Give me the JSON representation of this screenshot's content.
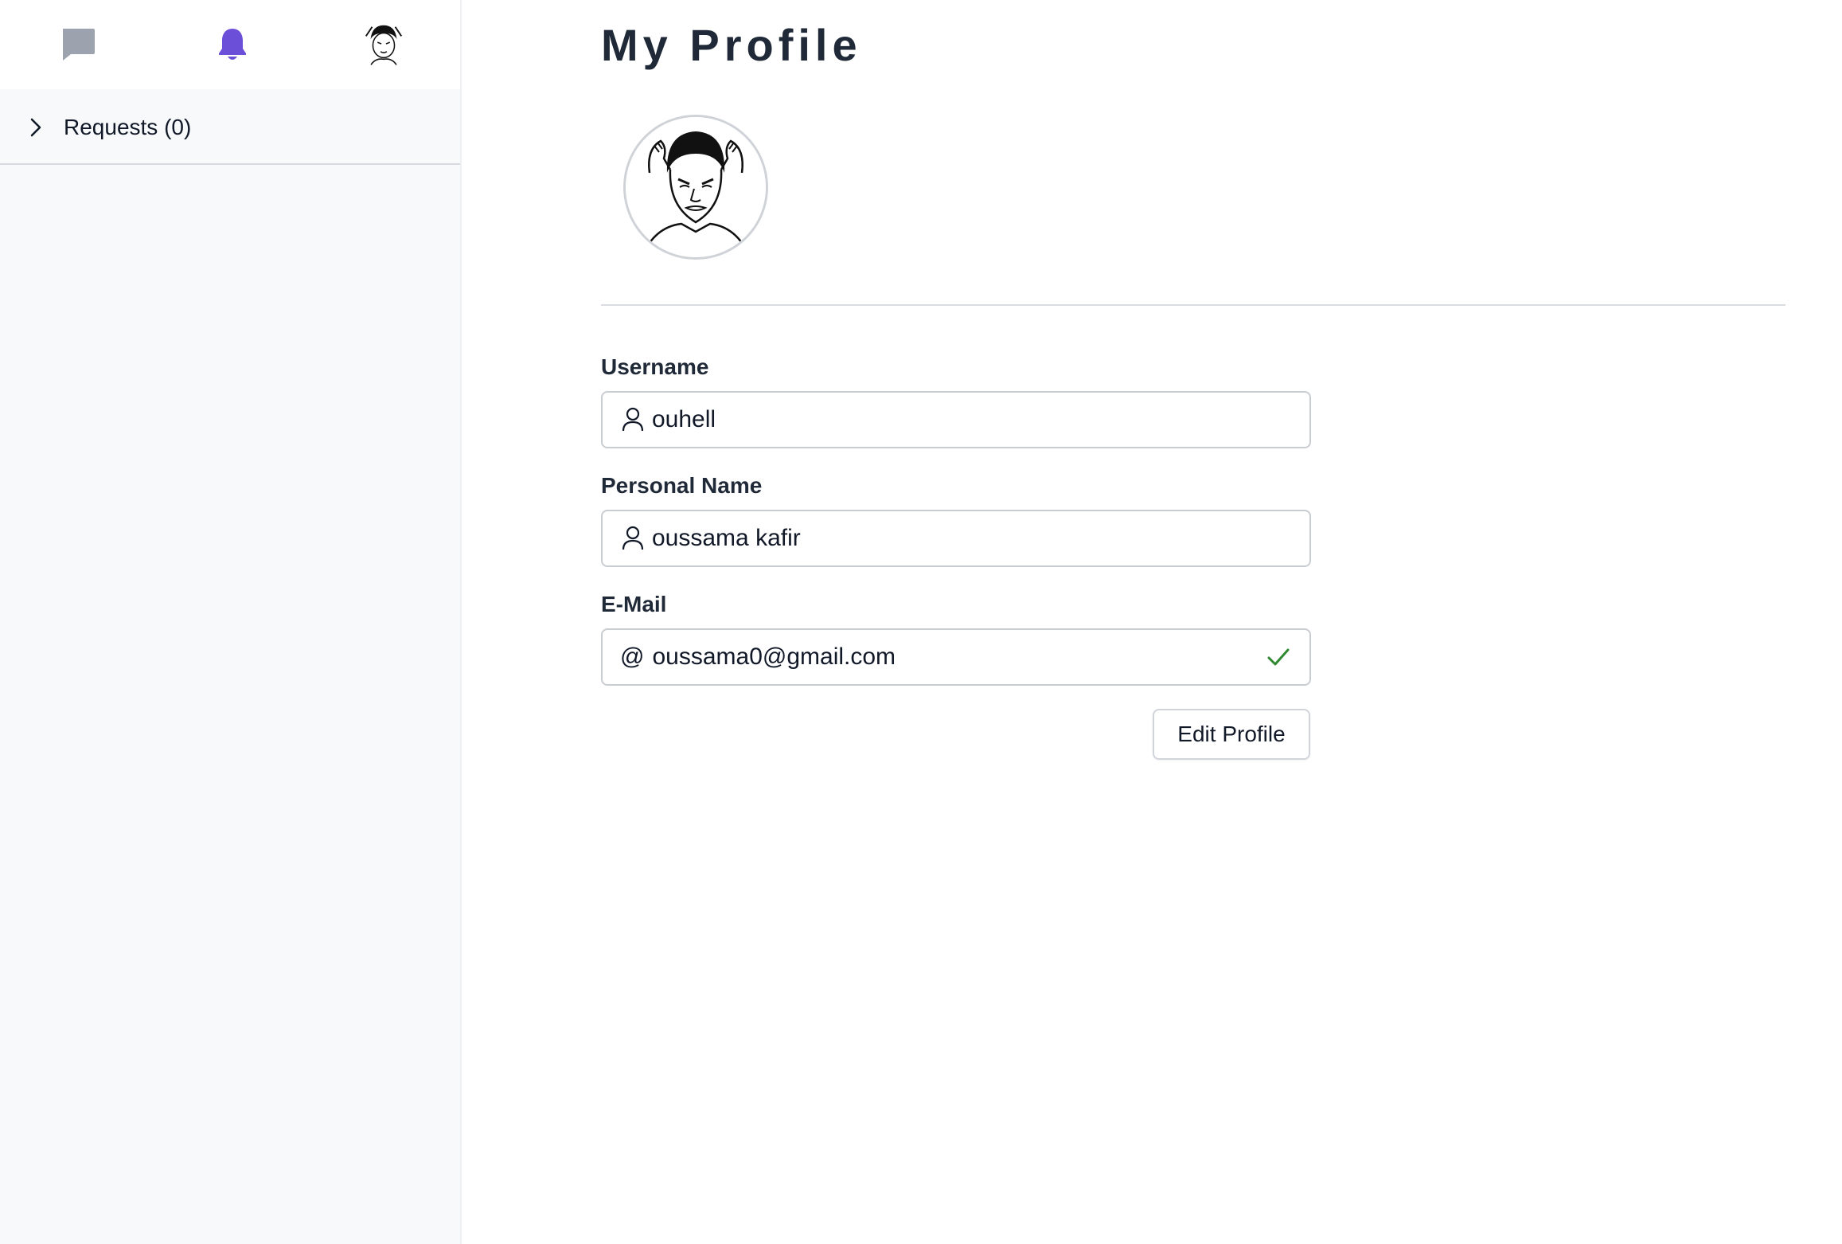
{
  "sidebar": {
    "icons": {
      "chat": "chat-bubble-icon",
      "notifications": "bell-icon",
      "avatar": "user-avatar"
    },
    "requests": {
      "label": "Requests (0)"
    }
  },
  "main": {
    "title": "My Profile",
    "fields": {
      "username": {
        "label": "Username",
        "value": "ouhell",
        "icon": "user-icon"
      },
      "personal_name": {
        "label": "Personal Name",
        "value": "oussama kafir",
        "icon": "user-icon"
      },
      "email": {
        "label": "E-Mail",
        "prefix": "@",
        "value": "oussama0@gmail.com",
        "status_icon": "check-icon"
      }
    },
    "edit_button": "Edit Profile"
  },
  "colors": {
    "accent": "#6b4fd8",
    "chat_icon": "#9ca3af",
    "valid": "#2f8a2f",
    "sidebar_bg": "#f8f9fb"
  }
}
